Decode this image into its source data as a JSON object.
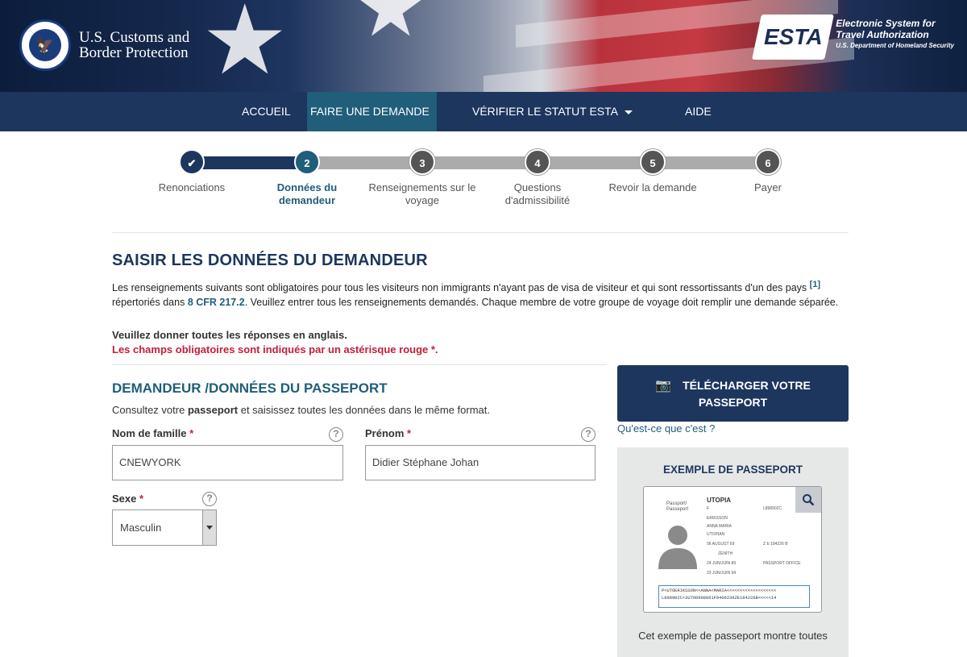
{
  "header": {
    "agency_line1": "U.S. Customs and",
    "agency_line2": "Border Protection",
    "esta_word": "ESTA",
    "esta_sub_line1": "Electronic System for",
    "esta_sub_line2": "Travel Authorization",
    "esta_sub_line3": "U.S. Department of Homeland Security"
  },
  "nav": {
    "home": "ACCUEIL",
    "apply": "FAIRE UNE DEMANDE",
    "check_status": "VÉRIFIER LE STATUT ESTA",
    "help": "AIDE"
  },
  "steps": [
    {
      "number": "✔",
      "label": "Renonciations",
      "state": "done"
    },
    {
      "number": "2",
      "label": "Données du demandeur",
      "state": "current"
    },
    {
      "number": "3",
      "label": "Renseignements sur le voyage",
      "state": "todo"
    },
    {
      "number": "4",
      "label": "Questions d'admissibilité",
      "state": "todo"
    },
    {
      "number": "5",
      "label": "Revoir la demande",
      "state": "todo"
    },
    {
      "number": "6",
      "label": "Payer",
      "state": "todo"
    }
  ],
  "page": {
    "title": "SAISIR LES DONNÉES DU DEMANDEUR",
    "intro_part1": "Les renseignements suivants sont obligatoires pour tous les visiteurs non immigrants n'ayant pas de visa de visiteur et qui sont ressortissants d'un des pays",
    "intro_ref": "[1]",
    "intro_part2": "répertoriés dans",
    "intro_link": "8 CFR 217.2",
    "intro_part3": ". Veuillez entrer tous les renseignements demandés. Chaque membre de votre groupe de voyage doit remplir une demande séparée.",
    "english_note": "Veuillez donner toutes les réponses en anglais.",
    "required_note": "Les champs obligatoires sont indiqués par un astérisque rouge *."
  },
  "section": {
    "title": "DEMANDEUR /DONNÉES DU PASSEPORT",
    "consult_part1": "Consultez votre",
    "consult_bold": "passeport",
    "consult_part2": "et saisissez toutes les données dans le même format."
  },
  "form": {
    "last_name_label": "Nom de famille",
    "last_name_value": "CNEWYORK",
    "first_name_label": "Prénom",
    "first_name_value": "Didier Stéphane Johan",
    "sex_label": "Sexe",
    "sex_value": "Masculin",
    "asterisk": "*",
    "help_glyph": "?"
  },
  "sidebar": {
    "upload_line1": "TÉLÉCHARGER VOTRE",
    "upload_line2": "PASSEPORT",
    "whats_this": "Qu'est-ce que c'est ?",
    "example_title": "EXEMPLE DE PASSEPORT",
    "passport_country": "UTOPIA",
    "passport_type": "Passport/ Passeport",
    "passport_surname": "ERIKSSON",
    "passport_given": "ANNA MARIA",
    "passport_nationality": "UTOPIAN",
    "passport_dob": "06 AUGUST 69",
    "passport_sex": "F",
    "passport_birthplace": "ZENITH",
    "passport_issue": "24 JUN/JUIN 89",
    "passport_expiry": "23 JUN/JUIN 94",
    "passport_number": "L898902C",
    "passport_personal_no": "Z E 184226 B",
    "passport_authority": "PASSPORT OFFICE",
    "passport_mrz_1": "P<UTOERIKSSON<<ANNA<MARIA<<<<<<<<<<<<<<<<<<<",
    "passport_mrz_2": "L898902C<3UTO6908061F9406236ZE184226B<<<<<14",
    "caption": "Cet exemple de passeport montre toutes"
  },
  "colors": {
    "navy": "#1c365e",
    "teal": "#205e7a",
    "required_red": "#c41e3a"
  }
}
